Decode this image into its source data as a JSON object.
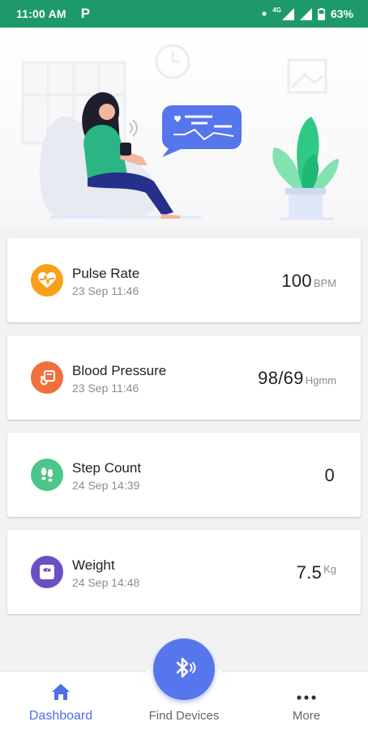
{
  "status_bar": {
    "time": "11:00 AM",
    "network": "4G",
    "battery": "63%"
  },
  "readings": [
    {
      "title": "Pulse Rate",
      "timestamp": "23 Sep 11:46",
      "value": "100",
      "unit": "BPM",
      "color": "#f9a11b",
      "icon": "heart-pulse-icon"
    },
    {
      "title": "Blood Pressure",
      "timestamp": "23 Sep 11:46",
      "value": "98/69",
      "unit": "Hgmm",
      "color": "#f26f3b",
      "icon": "blood-pressure-monitor-icon"
    },
    {
      "title": "Step Count",
      "timestamp": "24 Sep 14:39",
      "value": "0",
      "unit": "",
      "color": "#4cc68a",
      "icon": "footsteps-icon"
    },
    {
      "title": "Weight",
      "timestamp": "24 Sep 14:48",
      "value": "7.5",
      "unit": "Kg",
      "color": "#6a4fc6",
      "icon": "weighing-scale-icon"
    }
  ],
  "bottom_nav": {
    "dashboard": "Dashboard",
    "find_devices": "Find Devices",
    "more": "More"
  },
  "colors": {
    "status_bar": "#1e9a6a",
    "accent": "#5676ee",
    "active_tab": "#4f6fe6"
  }
}
